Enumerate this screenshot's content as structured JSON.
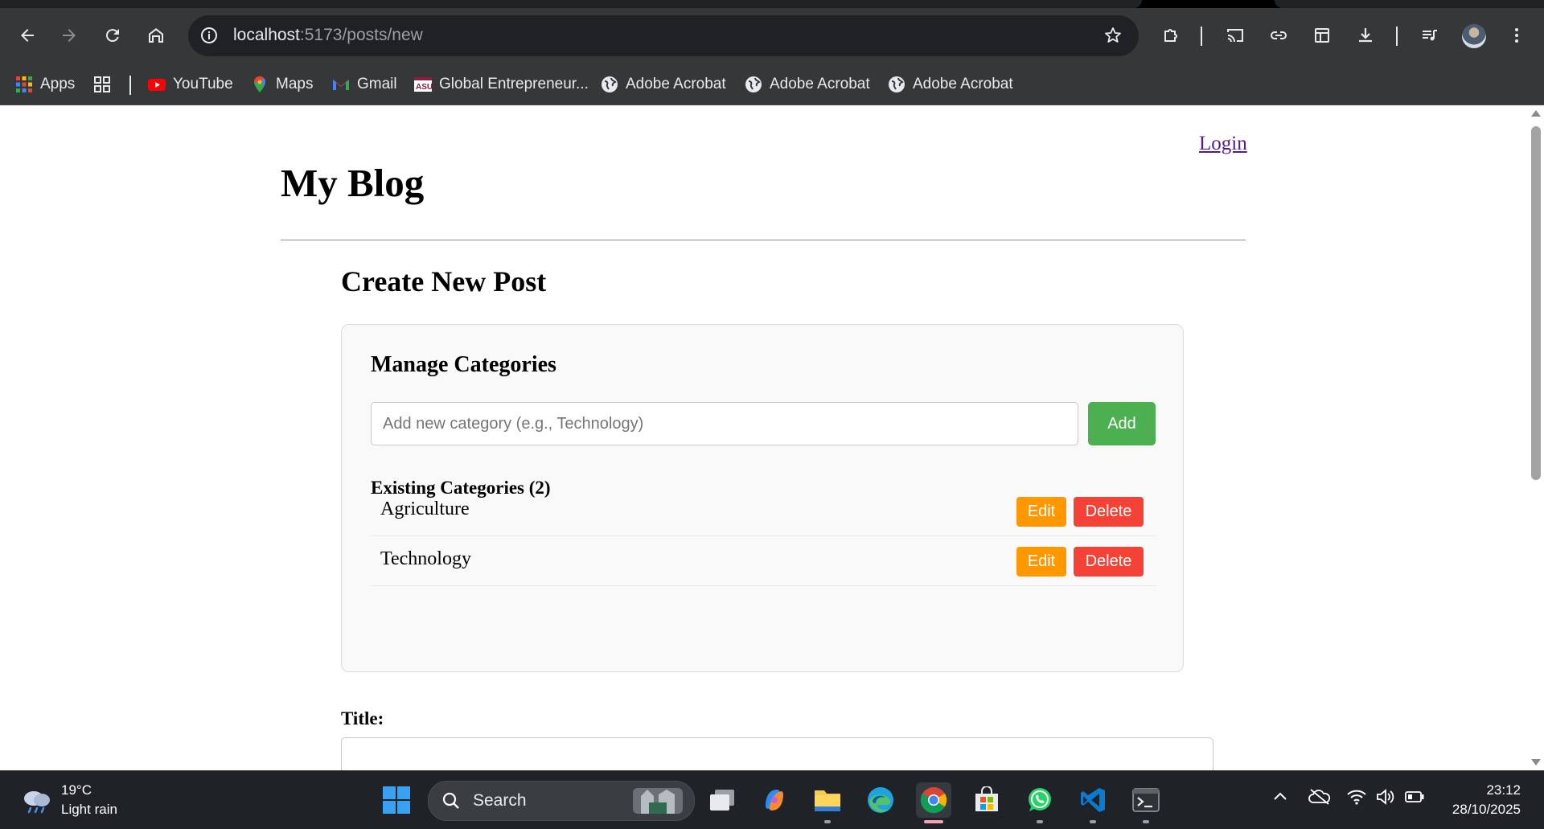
{
  "browser": {
    "url_host": "localhost",
    "url_path": ":5173/posts/new",
    "bookmarks": [
      {
        "label": "Apps",
        "icon": "apps-grid-icon"
      },
      {
        "label": "YouTube",
        "icon": "youtube-icon"
      },
      {
        "label": "Maps",
        "icon": "maps-icon"
      },
      {
        "label": "Gmail",
        "icon": "gmail-icon"
      },
      {
        "label": "Global Entrepreneur...",
        "icon": "asu-icon"
      },
      {
        "label": "Adobe Acrobat",
        "icon": "globe-icon"
      },
      {
        "label": "Adobe Acrobat",
        "icon": "globe-icon"
      },
      {
        "label": "Adobe Acrobat",
        "icon": "globe-icon"
      }
    ]
  },
  "page": {
    "login_link": "Login",
    "site_title": "My Blog",
    "heading": "Create New Post",
    "categories": {
      "heading": "Manage Categories",
      "input_placeholder": "Add new category (e.g., Technology)",
      "input_value": "",
      "add_label": "Add",
      "existing_heading": "Existing Categories (2)",
      "items": [
        {
          "name": "Agriculture",
          "edit_label": "Edit",
          "delete_label": "Delete"
        },
        {
          "name": "Technology",
          "edit_label": "Edit",
          "delete_label": "Delete"
        }
      ]
    },
    "title_label": "Title:",
    "title_value": ""
  },
  "colors": {
    "add_button": "#4caf50",
    "edit_button": "#ff9800",
    "delete_button": "#f44336",
    "link": "#551a8b"
  },
  "taskbar": {
    "weather_temp": "19°C",
    "weather_desc": "Light rain",
    "search_label": "Search",
    "time": "23:12",
    "date": "28/10/2025"
  }
}
